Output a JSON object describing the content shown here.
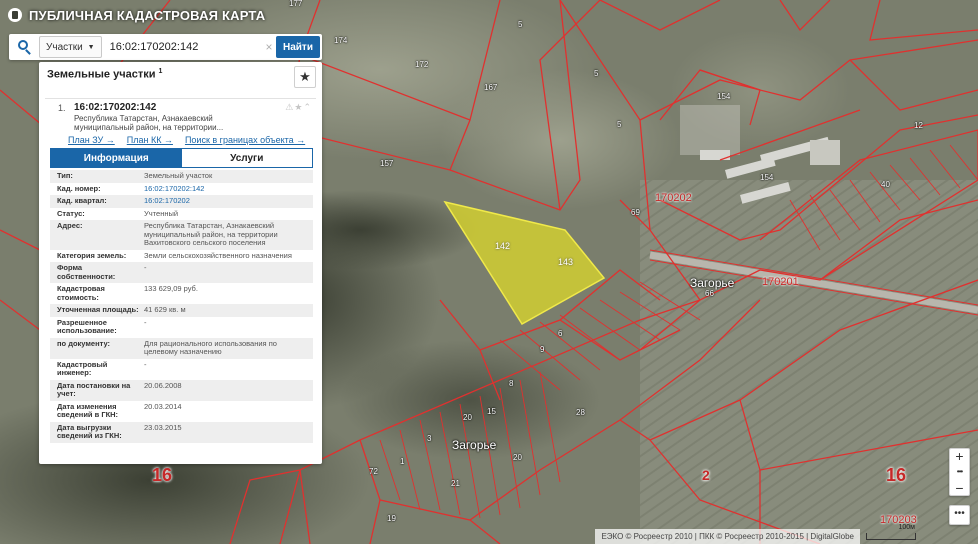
{
  "app": {
    "title": "ПУБЛИЧНАЯ КАДАСТРОВАЯ КАРТА"
  },
  "search": {
    "filter_label": "Участки",
    "query": "16:02:170202:142",
    "button_label": "Найти"
  },
  "panel": {
    "title": "Земельные участки",
    "count": "1",
    "result": {
      "index": "1.",
      "cad_number": "16:02:170202:142",
      "address_short": "Республика Татарстан, Азнакаевский муниципальный район, на территории...",
      "links": [
        "План ЗУ →",
        "План КК →",
        "Поиск в границах объекта →"
      ]
    },
    "tabs": [
      {
        "label": "Информация"
      },
      {
        "label": "Услуги"
      }
    ],
    "info": [
      {
        "k": "Тип:",
        "v": "Земельный участок"
      },
      {
        "k": "Кад. номер:",
        "v": "16:02:170202:142"
      },
      {
        "k": "Кад. квартал:",
        "v": "16:02:170202"
      },
      {
        "k": "Статус:",
        "v": "Учтенный"
      },
      {
        "k": "Адрес:",
        "v": "Республика Татарстан, Азнакаевский муниципальный район, на территории Вахитовского сельского поселения"
      },
      {
        "k": "Категория земель:",
        "v": "Земли сельскохозяйственного назначения"
      },
      {
        "k": "Форма собственности:",
        "v": "-"
      },
      {
        "k": "Кадастровая стоимость:",
        "v": "133 629,09 руб."
      },
      {
        "k": "Уточненная площадь:",
        "v": "41 629 кв. м"
      },
      {
        "k": "Разрешенное использование:",
        "v": "-"
      },
      {
        "k": "по документу:",
        "v": "Для рационального использования по целевому назначению"
      },
      {
        "k": "Кадастровый инженер:",
        "v": "-"
      },
      {
        "k": "Дата постановки на учет:",
        "v": "20.06.2008"
      },
      {
        "k": "Дата изменения сведений в ГКН:",
        "v": "20.03.2014"
      },
      {
        "k": "Дата выгрузки сведений из ГКН:",
        "v": "23.03.2015"
      }
    ]
  },
  "map": {
    "selected_fill": "#d7d32d",
    "boundary_color": "#e0312f",
    "parcel_labels": [
      "177",
      "174",
      "5",
      "172",
      "167",
      "5",
      "5",
      "157",
      "142",
      "143",
      "69",
      "154",
      "154",
      "170202",
      "12",
      "40",
      "Загорье",
      "66",
      "170201",
      "19",
      "28",
      "Загорье",
      "15",
      "20",
      "2",
      "16",
      "16",
      "170203",
      "3",
      "8",
      "9",
      "20",
      "6",
      "1",
      "21",
      "72"
    ],
    "big_labels": {
      "left": "16",
      "center": "2",
      "right": "16"
    },
    "quarters": {
      "q1": "170202",
      "q2": "170201",
      "q3": "170203"
    },
    "villages": {
      "v1": "Загорье",
      "v2": "Загорье"
    }
  },
  "controls": {
    "zoom_in": "+",
    "zoom_out": "−",
    "more": "•••"
  },
  "attribution": "ЕЭКО © Росреестр 2010 | ПКК © Росреестр 2010-2015 | DigitalGlobe",
  "scale_label": "100м"
}
